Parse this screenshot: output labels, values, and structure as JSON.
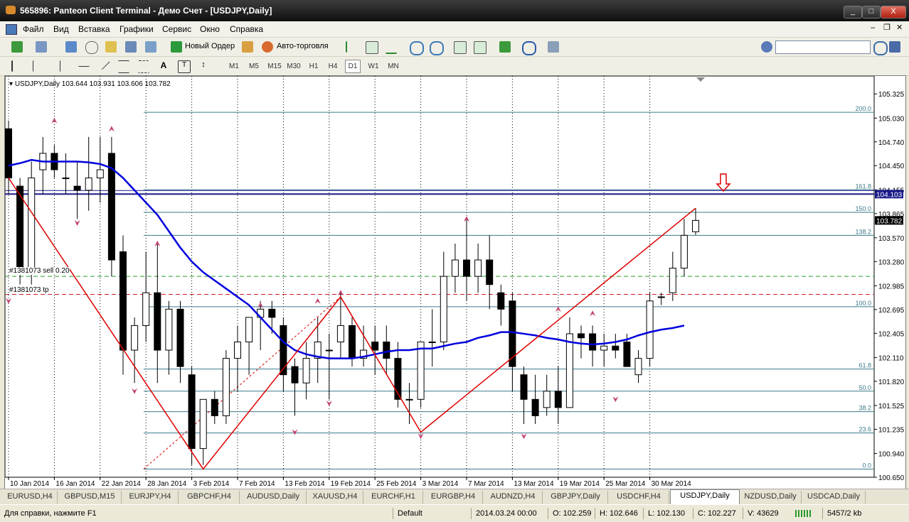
{
  "window": {
    "title": "565896: Panteon Client Terminal - Демо Счет - [USDJPY,Daily]",
    "minimize": "_",
    "maximize": "□",
    "close": "X"
  },
  "menu": [
    "Файл",
    "Вид",
    "Вставка",
    "Графики",
    "Сервис",
    "Окно",
    "Справка"
  ],
  "toolbar": {
    "new_order": "Новый Ордер",
    "autotrading": "Авто-торговля"
  },
  "timeframes": [
    "M1",
    "M5",
    "M15",
    "M30",
    "H1",
    "H4",
    "D1",
    "W1",
    "MN"
  ],
  "active_timeframe": "D1",
  "chart": {
    "header": "USDJPY,Daily  103.644 103.931 103.606 103.782",
    "order_labels": {
      "sell": "#1381073 sell 0.20",
      "tp": "#1381073 tp"
    },
    "colors": {
      "bull": "#ffffff",
      "bear": "#000000",
      "ma": "#0000dd",
      "zigzag": "#dd0000",
      "fib": "#3b7a8a",
      "level": "#1a1a8a",
      "fractal": "#c04070"
    },
    "price_highlight": {
      "level": "104.103",
      "current": "103.782"
    }
  },
  "chart_data": {
    "type": "candlestick",
    "symbol": "USDJPY",
    "timeframe": "Daily",
    "ohlc_header": {
      "open": 103.644,
      "high": 103.931,
      "low": 103.606,
      "close": 103.782
    },
    "y_ticks": [
      105.325,
      105.03,
      104.74,
      104.45,
      104.155,
      103.865,
      103.57,
      103.28,
      102.985,
      102.695,
      102.405,
      102.11,
      101.82,
      101.525,
      101.235,
      100.94,
      100.65
    ],
    "ylim": [
      100.65,
      105.5
    ],
    "x_ticks": [
      {
        "label": "10 Jan 2014",
        "i": 0
      },
      {
        "label": "16 Jan 2014",
        "i": 4
      },
      {
        "label": "22 Jan 2014",
        "i": 8
      },
      {
        "label": "28 Jan 2014",
        "i": 12
      },
      {
        "label": "3 Feb 2014",
        "i": 16
      },
      {
        "label": "7 Feb 2014",
        "i": 20
      },
      {
        "label": "13 Feb 2014",
        "i": 24
      },
      {
        "label": "19 Feb 2014",
        "i": 28
      },
      {
        "label": "25 Feb 2014",
        "i": 32
      },
      {
        "label": "3 Mar 2014",
        "i": 36
      },
      {
        "label": "7 Mar 2014",
        "i": 40
      },
      {
        "label": "13 Mar 2014",
        "i": 44
      },
      {
        "label": "19 Mar 2014",
        "i": 48
      },
      {
        "label": "25 Mar 2014",
        "i": 52
      },
      {
        "label": "30 Mar 2014",
        "i": 56
      }
    ],
    "candles": [
      [
        104.9,
        105.0,
        104.1,
        104.3
      ],
      [
        104.2,
        104.3,
        103.0,
        103.2
      ],
      [
        103.2,
        104.5,
        103.0,
        104.3
      ],
      [
        104.4,
        104.8,
        104.1,
        104.6
      ],
      [
        104.6,
        104.7,
        104.3,
        104.4
      ],
      [
        104.3,
        104.6,
        104.1,
        104.3
      ],
      [
        104.2,
        104.5,
        103.8,
        104.15
      ],
      [
        104.15,
        104.8,
        103.9,
        104.3
      ],
      [
        104.3,
        104.8,
        104.0,
        104.4
      ],
      [
        104.6,
        104.8,
        103.1,
        103.3
      ],
      [
        103.4,
        103.6,
        101.9,
        102.2
      ],
      [
        102.2,
        102.6,
        101.8,
        102.5
      ],
      [
        102.5,
        103.4,
        102.3,
        102.9
      ],
      [
        102.9,
        103.5,
        101.8,
        102.2
      ],
      [
        102.2,
        102.8,
        101.9,
        102.7
      ],
      [
        102.7,
        102.8,
        101.8,
        102.0
      ],
      [
        101.9,
        102.0,
        100.8,
        101.0
      ],
      [
        101.0,
        101.6,
        100.8,
        101.6
      ],
      [
        101.6,
        101.7,
        101.3,
        101.4
      ],
      [
        101.4,
        102.2,
        101.3,
        102.1
      ],
      [
        102.1,
        102.5,
        101.7,
        102.3
      ],
      [
        102.3,
        102.6,
        101.9,
        102.6
      ],
      [
        102.6,
        102.8,
        102.2,
        102.7
      ],
      [
        102.7,
        102.8,
        102.4,
        102.6
      ],
      [
        102.5,
        102.6,
        101.7,
        101.9
      ],
      [
        102.0,
        102.1,
        101.4,
        101.8
      ],
      [
        101.8,
        102.3,
        101.6,
        102.1
      ],
      [
        102.1,
        102.6,
        101.8,
        102.3
      ],
      [
        102.2,
        102.4,
        101.6,
        102.2
      ],
      [
        102.3,
        102.9,
        102.1,
        102.5
      ],
      [
        102.5,
        102.6,
        102.0,
        102.1
      ],
      [
        102.1,
        102.5,
        102.0,
        102.2
      ],
      [
        102.3,
        102.5,
        101.9,
        102.2
      ],
      [
        102.3,
        102.5,
        101.9,
        102.1
      ],
      [
        102.1,
        102.3,
        101.5,
        101.6
      ],
      [
        101.6,
        101.8,
        101.3,
        101.6
      ],
      [
        101.6,
        102.2,
        101.5,
        102.3
      ],
      [
        102.3,
        102.7,
        102.0,
        102.3
      ],
      [
        102.3,
        103.4,
        102.2,
        103.1
      ],
      [
        103.1,
        103.5,
        102.9,
        103.3
      ],
      [
        103.3,
        103.8,
        102.8,
        103.1
      ],
      [
        103.1,
        103.5,
        102.9,
        103.3
      ],
      [
        103.3,
        103.6,
        102.7,
        103.0
      ],
      [
        102.9,
        103.0,
        102.5,
        102.7
      ],
      [
        102.8,
        102.9,
        101.7,
        102.0
      ],
      [
        101.9,
        102.0,
        101.3,
        101.6
      ],
      [
        101.6,
        101.9,
        101.3,
        101.4
      ],
      [
        101.5,
        101.9,
        101.4,
        101.7
      ],
      [
        101.7,
        102.0,
        101.3,
        101.5
      ],
      [
        101.5,
        102.6,
        101.5,
        102.4
      ],
      [
        102.4,
        102.5,
        102.1,
        102.35
      ],
      [
        102.4,
        102.5,
        102.0,
        102.2
      ],
      [
        102.2,
        102.4,
        102.0,
        102.25
      ],
      [
        102.25,
        102.4,
        102.1,
        102.2
      ],
      [
        102.3,
        102.4,
        102.0,
        102.0
      ],
      [
        101.9,
        102.2,
        101.8,
        102.1
      ],
      [
        102.1,
        102.9,
        102.0,
        102.8
      ],
      [
        102.85,
        102.9,
        102.75,
        102.85
      ],
      [
        102.9,
        103.4,
        102.8,
        103.2
      ],
      [
        103.2,
        103.8,
        103.1,
        103.6
      ],
      [
        103.644,
        103.931,
        103.606,
        103.782
      ]
    ],
    "ma_line": [
      104.45,
      104.48,
      104.52,
      104.5,
      104.5,
      104.5,
      104.5,
      104.49,
      104.47,
      104.42,
      104.3,
      104.15,
      104.0,
      103.85,
      103.65,
      103.45,
      103.28,
      103.15,
      103.05,
      102.95,
      102.85,
      102.75,
      102.6,
      102.45,
      102.3,
      102.2,
      102.15,
      102.12,
      102.1,
      102.1,
      102.1,
      102.12,
      102.15,
      102.18,
      102.2,
      102.2,
      102.22,
      102.22,
      102.25,
      102.28,
      102.3,
      102.35,
      102.38,
      102.42,
      102.42,
      102.4,
      102.38,
      102.35,
      102.33,
      102.3,
      102.28,
      102.27,
      102.28,
      102.3,
      102.33,
      102.38,
      102.42,
      102.45,
      102.47,
      102.5
    ],
    "zigzag": [
      [
        0,
        104.3
      ],
      [
        17,
        100.75
      ],
      [
        29,
        102.85
      ],
      [
        36,
        101.2
      ],
      [
        60,
        103.931
      ]
    ],
    "fib_levels": [
      {
        "label": "200.0",
        "price": 105.1
      },
      {
        "label": "161.8",
        "price": 104.155
      },
      {
        "label": "150.0",
        "price": 103.88
      },
      {
        "label": "138.2",
        "price": 103.6
      },
      {
        "label": "100.0",
        "price": 102.73
      },
      {
        "label": "61.8",
        "price": 101.97
      },
      {
        "label": "50.0",
        "price": 101.7
      },
      {
        "label": "38.2",
        "price": 101.45
      },
      {
        "label": "23.6",
        "price": 101.19
      },
      {
        "label": "0.0",
        "price": 100.75
      }
    ],
    "hline": 104.103,
    "sell_level": 103.1,
    "tp_level": 102.88
  },
  "tabs": [
    "EURUSD,H4",
    "GBPUSD,M15",
    "EURJPY,H4",
    "GBPCHF,H4",
    "AUDUSD,Daily",
    "XAUUSD,H4",
    "EURCHF,H1",
    "EURGBP,H4",
    "AUDNZD,H4",
    "GBPJPY,Daily",
    "USDCHF,H4",
    "USDJPY,Daily",
    "NZDUSD,Daily",
    "USDCAD,Daily"
  ],
  "active_tab": "USDJPY,Daily",
  "status": {
    "help": "Для справки, нажмите F1",
    "profile": "Default",
    "time": "2014.03.24 00:00",
    "open": "O: 102.259",
    "high": "H: 102.646",
    "low": "L: 102.130",
    "close": "C: 102.227",
    "volume": "V: 43629",
    "traffic": "5457/2 kb"
  }
}
